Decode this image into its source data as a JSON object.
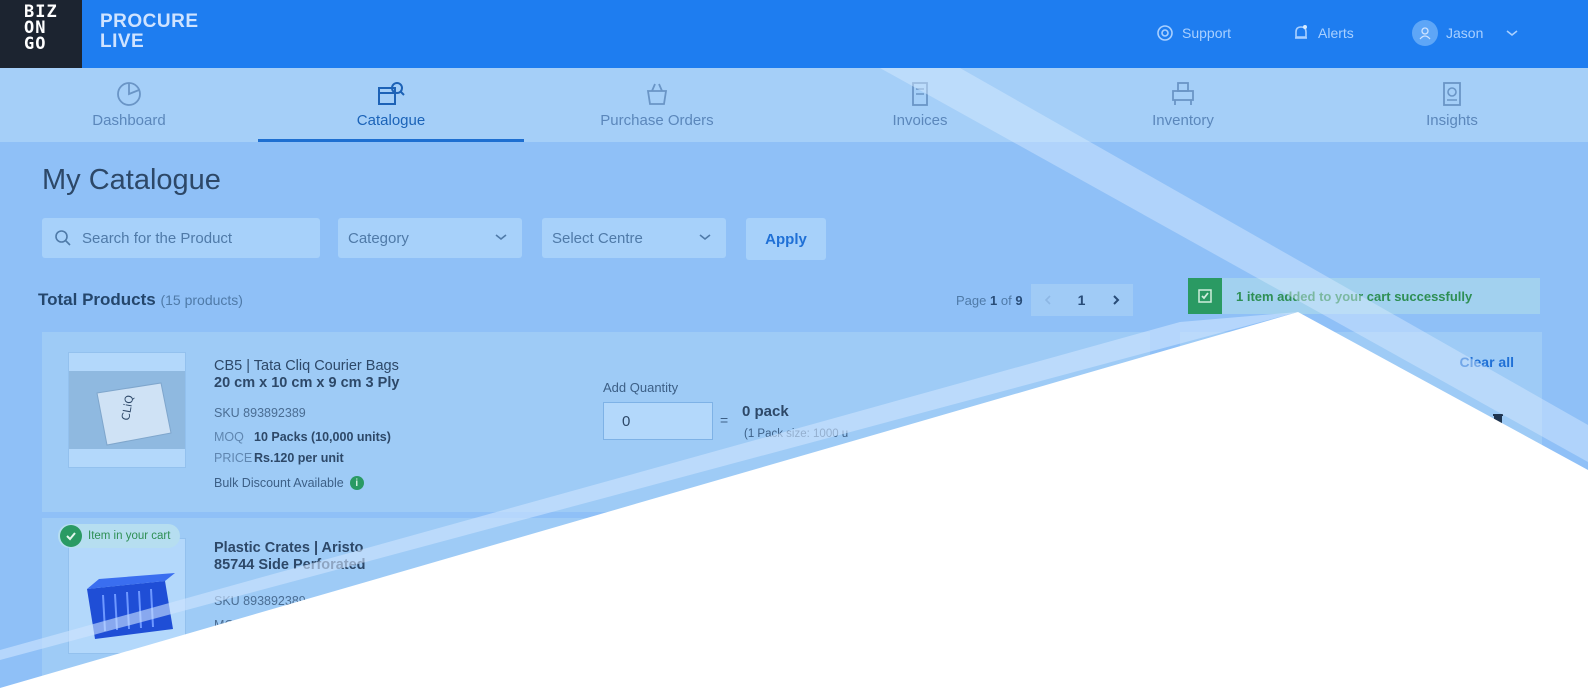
{
  "brand": {
    "logo": "BIZ ON GO",
    "logo_lines": [
      "BIZ",
      "ON",
      "GO"
    ],
    "name_line1": "PROCURE",
    "name_line2": "LIVE"
  },
  "topbar": {
    "support": "Support",
    "alerts": "Alerts",
    "user": "Jason"
  },
  "nav": [
    {
      "label": "Dashboard",
      "icon": "pie-chart-icon"
    },
    {
      "label": "Catalogue",
      "icon": "catalogue-search-icon",
      "active": true
    },
    {
      "label": "Purchase Orders",
      "icon": "basket-icon"
    },
    {
      "label": "Invoices",
      "icon": "invoice-icon"
    },
    {
      "label": "Inventory",
      "icon": "inventory-icon"
    },
    {
      "label": "Insights",
      "icon": "insights-icon"
    }
  ],
  "page": {
    "title": "My Catalogue"
  },
  "filters": {
    "search_placeholder": "Search for the Product",
    "category": "Category",
    "centre": "Select Centre",
    "apply": "Apply"
  },
  "summary": {
    "title": "Total Products",
    "count": "(15 products)"
  },
  "pager": {
    "page_prefix": "Page",
    "current": "1",
    "of": "of",
    "total": "9",
    "page_button": "1"
  },
  "toast": {
    "message": "1 item added to your cart successfully"
  },
  "cart": {
    "clear_all": "Clear all"
  },
  "products": [
    {
      "name_line1": "CB5 | Tata Cliq Courier Bags",
      "name_line2": "20 cm x 10 cm x 9 cm 3 Ply",
      "sku": "SKU 893892389",
      "moq_label": "MOQ",
      "moq": "10 Packs (10,000 units)",
      "price_label": "PRICE",
      "price": "Rs.120 per unit",
      "bulk": "Bulk Discount Available",
      "add_qty_label": "Add Quantity",
      "qty_value": "0",
      "equals": "=",
      "pack": "0 pack",
      "pack_size": "(1 Pack size: 1000 u"
    },
    {
      "badge": "Item in your cart",
      "name_line1": "Plastic Crates | Aristo",
      "name_line2": "85744 Side Perforated",
      "sku": "SKU 893892389",
      "moq_partial": "MO"
    }
  ],
  "colors": {
    "topbar": "#1e7df0",
    "accent": "#1f70d6",
    "success": "#2a9a63",
    "overlay": "#ffffff"
  }
}
